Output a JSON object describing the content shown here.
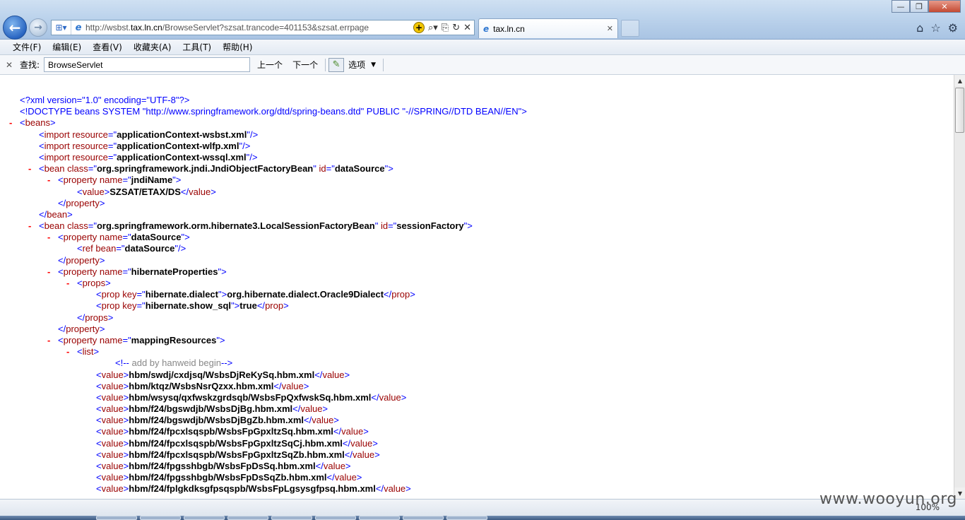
{
  "browser": {
    "url_prefix": "http://wsbst.",
    "url_host": "tax.ln.cn",
    "url_rest": "/BrowseServlet?szsat.trancode=401153&szsat.errpage",
    "tab_title": "tax.ln.cn",
    "tab_close": "✕",
    "window_controls": {
      "minimize": "—",
      "maximize": "❐",
      "close": "✕"
    },
    "zoom": "100%"
  },
  "menu": [
    "文件(F)",
    "编辑(E)",
    "查看(V)",
    "收藏夹(A)",
    "工具(T)",
    "帮助(H)"
  ],
  "find": {
    "close": "✕",
    "label": "查找:",
    "value": "BrowseServlet",
    "prev": "上一个",
    "next": "下一个",
    "options": "选项"
  },
  "watermark": "www.wooyun.org",
  "xml_lines": [
    {
      "minus": false,
      "indent": 0,
      "parts": [
        [
          "pi",
          "<?xml version=\"1.0\" encoding=\"UTF-8\"?>"
        ]
      ]
    },
    {
      "minus": false,
      "indent": 0,
      "parts": [
        [
          "pi",
          "<!DOCTYPE beans SYSTEM \"http://www.springframework.org/dtd/spring-beans.dtd\" PUBLIC \"-//SPRING//DTD BEAN//EN\">"
        ]
      ]
    },
    {
      "minus": true,
      "indent": 0,
      "parts": [
        [
          "bl",
          "<"
        ],
        [
          "tg",
          "beans"
        ],
        [
          "bl",
          ">"
        ]
      ]
    },
    {
      "minus": false,
      "indent": 1,
      "parts": [
        [
          "bl",
          "<"
        ],
        [
          "tg",
          "import"
        ],
        [
          "tg",
          " resource"
        ],
        [
          "bl",
          "=\""
        ],
        [
          "bd",
          "applicationContext-wsbst.xml"
        ],
        [
          "bl",
          "\"/>"
        ]
      ]
    },
    {
      "minus": false,
      "indent": 1,
      "parts": [
        [
          "bl",
          "<"
        ],
        [
          "tg",
          "import"
        ],
        [
          "tg",
          " resource"
        ],
        [
          "bl",
          "=\""
        ],
        [
          "bd",
          "applicationContext-wlfp.xml"
        ],
        [
          "bl",
          "\"/>"
        ]
      ]
    },
    {
      "minus": false,
      "indent": 1,
      "parts": [
        [
          "bl",
          "<"
        ],
        [
          "tg",
          "import"
        ],
        [
          "tg",
          " resource"
        ],
        [
          "bl",
          "=\""
        ],
        [
          "bd",
          "applicationContext-wssql.xml"
        ],
        [
          "bl",
          "\"/>"
        ]
      ]
    },
    {
      "minus": true,
      "indent": 1,
      "parts": [
        [
          "bl",
          "<"
        ],
        [
          "tg",
          "bean"
        ],
        [
          "tg",
          " class"
        ],
        [
          "bl",
          "=\""
        ],
        [
          "bd",
          "org.springframework.jndi.JndiObjectFactoryBean"
        ],
        [
          "bl",
          "\""
        ],
        [
          "tg",
          " id"
        ],
        [
          "bl",
          "=\""
        ],
        [
          "bd",
          "dataSource"
        ],
        [
          "bl",
          "\">"
        ]
      ]
    },
    {
      "minus": true,
      "indent": 2,
      "parts": [
        [
          "bl",
          "<"
        ],
        [
          "tg",
          "property"
        ],
        [
          "tg",
          " name"
        ],
        [
          "bl",
          "=\""
        ],
        [
          "bd",
          "jndiName"
        ],
        [
          "bl",
          "\">"
        ]
      ]
    },
    {
      "minus": false,
      "indent": 3,
      "parts": [
        [
          "bl",
          "<"
        ],
        [
          "tg",
          "value"
        ],
        [
          "bl",
          ">"
        ],
        [
          "bd",
          "SZSAT/ETAX/DS"
        ],
        [
          "bl",
          "</"
        ],
        [
          "tg",
          "value"
        ],
        [
          "bl",
          ">"
        ]
      ]
    },
    {
      "minus": false,
      "indent": 2,
      "parts": [
        [
          "bl",
          "</"
        ],
        [
          "tg",
          "property"
        ],
        [
          "bl",
          ">"
        ]
      ]
    },
    {
      "minus": false,
      "indent": 1,
      "parts": [
        [
          "bl",
          "</"
        ],
        [
          "tg",
          "bean"
        ],
        [
          "bl",
          ">"
        ]
      ]
    },
    {
      "minus": true,
      "indent": 1,
      "parts": [
        [
          "bl",
          "<"
        ],
        [
          "tg",
          "bean"
        ],
        [
          "tg",
          " class"
        ],
        [
          "bl",
          "=\""
        ],
        [
          "bd",
          "org.springframework.orm.hibernate3.LocalSessionFactoryBean"
        ],
        [
          "bl",
          "\""
        ],
        [
          "tg",
          " id"
        ],
        [
          "bl",
          "=\""
        ],
        [
          "bd",
          "sessionFactory"
        ],
        [
          "bl",
          "\">"
        ]
      ]
    },
    {
      "minus": true,
      "indent": 2,
      "parts": [
        [
          "bl",
          "<"
        ],
        [
          "tg",
          "property"
        ],
        [
          "tg",
          " name"
        ],
        [
          "bl",
          "=\""
        ],
        [
          "bd",
          "dataSource"
        ],
        [
          "bl",
          "\">"
        ]
      ]
    },
    {
      "minus": false,
      "indent": 3,
      "parts": [
        [
          "bl",
          "<"
        ],
        [
          "tg",
          "ref"
        ],
        [
          "tg",
          " bean"
        ],
        [
          "bl",
          "=\""
        ],
        [
          "bd",
          "dataSource"
        ],
        [
          "bl",
          "\"/>"
        ]
      ]
    },
    {
      "minus": false,
      "indent": 2,
      "parts": [
        [
          "bl",
          "</"
        ],
        [
          "tg",
          "property"
        ],
        [
          "bl",
          ">"
        ]
      ]
    },
    {
      "minus": true,
      "indent": 2,
      "parts": [
        [
          "bl",
          "<"
        ],
        [
          "tg",
          "property"
        ],
        [
          "tg",
          " name"
        ],
        [
          "bl",
          "=\""
        ],
        [
          "bd",
          "hibernateProperties"
        ],
        [
          "bl",
          "\">"
        ]
      ]
    },
    {
      "minus": true,
      "indent": 3,
      "parts": [
        [
          "bl",
          "<"
        ],
        [
          "tg",
          "props"
        ],
        [
          "bl",
          ">"
        ]
      ]
    },
    {
      "minus": false,
      "indent": 4,
      "parts": [
        [
          "bl",
          "<"
        ],
        [
          "tg",
          "prop"
        ],
        [
          "tg",
          " key"
        ],
        [
          "bl",
          "=\""
        ],
        [
          "bd",
          "hibernate.dialect"
        ],
        [
          "bl",
          "\">"
        ],
        [
          "bd",
          "org.hibernate.dialect.Oracle9Dialect"
        ],
        [
          "bl",
          "</"
        ],
        [
          "tg",
          "prop"
        ],
        [
          "bl",
          ">"
        ]
      ]
    },
    {
      "minus": false,
      "indent": 4,
      "parts": [
        [
          "bl",
          "<"
        ],
        [
          "tg",
          "prop"
        ],
        [
          "tg",
          " key"
        ],
        [
          "bl",
          "=\""
        ],
        [
          "bd",
          "hibernate.show_sql"
        ],
        [
          "bl",
          "\">"
        ],
        [
          "bd",
          "true"
        ],
        [
          "bl",
          "</"
        ],
        [
          "tg",
          "prop"
        ],
        [
          "bl",
          ">"
        ]
      ]
    },
    {
      "minus": false,
      "indent": 3,
      "parts": [
        [
          "bl",
          "</"
        ],
        [
          "tg",
          "props"
        ],
        [
          "bl",
          ">"
        ]
      ]
    },
    {
      "minus": false,
      "indent": 2,
      "parts": [
        [
          "bl",
          "</"
        ],
        [
          "tg",
          "property"
        ],
        [
          "bl",
          ">"
        ]
      ]
    },
    {
      "minus": true,
      "indent": 2,
      "parts": [
        [
          "bl",
          "<"
        ],
        [
          "tg",
          "property"
        ],
        [
          "tg",
          " name"
        ],
        [
          "bl",
          "=\""
        ],
        [
          "bd",
          "mappingResources"
        ],
        [
          "bl",
          "\">"
        ]
      ]
    },
    {
      "minus": true,
      "indent": 3,
      "parts": [
        [
          "bl",
          "<"
        ],
        [
          "tg",
          "list"
        ],
        [
          "bl",
          ">"
        ]
      ]
    },
    {
      "minus": false,
      "indent": 5,
      "parts": [
        [
          "bl",
          "<!--"
        ],
        [
          "cm",
          " add by hanweid begin"
        ],
        [
          "bl",
          "-->"
        ]
      ]
    },
    {
      "minus": false,
      "indent": 4,
      "parts": [
        [
          "bl",
          "<"
        ],
        [
          "tg",
          "value"
        ],
        [
          "bl",
          ">"
        ],
        [
          "bd",
          "hbm/swdj/cxdjsq/WsbsDjReKySq.hbm.xml"
        ],
        [
          "bl",
          "</"
        ],
        [
          "tg",
          "value"
        ],
        [
          "bl",
          ">"
        ]
      ]
    },
    {
      "minus": false,
      "indent": 4,
      "parts": [
        [
          "bl",
          "<"
        ],
        [
          "tg",
          "value"
        ],
        [
          "bl",
          ">"
        ],
        [
          "bd",
          "hbm/ktqz/WsbsNsrQzxx.hbm.xml"
        ],
        [
          "bl",
          "</"
        ],
        [
          "tg",
          "value"
        ],
        [
          "bl",
          ">"
        ]
      ]
    },
    {
      "minus": false,
      "indent": 4,
      "parts": [
        [
          "bl",
          "<"
        ],
        [
          "tg",
          "value"
        ],
        [
          "bl",
          ">"
        ],
        [
          "bd",
          "hbm/wsysq/qxfwskzgrdsqb/WsbsFpQxfwskSq.hbm.xml"
        ],
        [
          "bl",
          "</"
        ],
        [
          "tg",
          "value"
        ],
        [
          "bl",
          ">"
        ]
      ]
    },
    {
      "minus": false,
      "indent": 4,
      "parts": [
        [
          "bl",
          "<"
        ],
        [
          "tg",
          "value"
        ],
        [
          "bl",
          ">"
        ],
        [
          "bd",
          "hbm/f24/bgswdjb/WsbsDjBg.hbm.xml"
        ],
        [
          "bl",
          "</"
        ],
        [
          "tg",
          "value"
        ],
        [
          "bl",
          ">"
        ]
      ]
    },
    {
      "minus": false,
      "indent": 4,
      "parts": [
        [
          "bl",
          "<"
        ],
        [
          "tg",
          "value"
        ],
        [
          "bl",
          ">"
        ],
        [
          "bd",
          "hbm/f24/bgswdjb/WsbsDjBgZb.hbm.xml"
        ],
        [
          "bl",
          "</"
        ],
        [
          "tg",
          "value"
        ],
        [
          "bl",
          ">"
        ]
      ]
    },
    {
      "minus": false,
      "indent": 4,
      "parts": [
        [
          "bl",
          "<"
        ],
        [
          "tg",
          "value"
        ],
        [
          "bl",
          ">"
        ],
        [
          "bd",
          "hbm/f24/fpcxlsqspb/WsbsFpGpxltzSq.hbm.xml"
        ],
        [
          "bl",
          "</"
        ],
        [
          "tg",
          "value"
        ],
        [
          "bl",
          ">"
        ]
      ]
    },
    {
      "minus": false,
      "indent": 4,
      "parts": [
        [
          "bl",
          "<"
        ],
        [
          "tg",
          "value"
        ],
        [
          "bl",
          ">"
        ],
        [
          "bd",
          "hbm/f24/fpcxlsqspb/WsbsFpGpxltzSqCj.hbm.xml"
        ],
        [
          "bl",
          "</"
        ],
        [
          "tg",
          "value"
        ],
        [
          "bl",
          ">"
        ]
      ]
    },
    {
      "minus": false,
      "indent": 4,
      "parts": [
        [
          "bl",
          "<"
        ],
        [
          "tg",
          "value"
        ],
        [
          "bl",
          ">"
        ],
        [
          "bd",
          "hbm/f24/fpcxlsqspb/WsbsFpGpxltzSqZb.hbm.xml"
        ],
        [
          "bl",
          "</"
        ],
        [
          "tg",
          "value"
        ],
        [
          "bl",
          ">"
        ]
      ]
    },
    {
      "minus": false,
      "indent": 4,
      "parts": [
        [
          "bl",
          "<"
        ],
        [
          "tg",
          "value"
        ],
        [
          "bl",
          ">"
        ],
        [
          "bd",
          "hbm/f24/fpgsshbgb/WsbsFpDsSq.hbm.xml"
        ],
        [
          "bl",
          "</"
        ],
        [
          "tg",
          "value"
        ],
        [
          "bl",
          ">"
        ]
      ]
    },
    {
      "minus": false,
      "indent": 4,
      "parts": [
        [
          "bl",
          "<"
        ],
        [
          "tg",
          "value"
        ],
        [
          "bl",
          ">"
        ],
        [
          "bd",
          "hbm/f24/fpgsshbgb/WsbsFpDsSqZb.hbm.xml"
        ],
        [
          "bl",
          "</"
        ],
        [
          "tg",
          "value"
        ],
        [
          "bl",
          ">"
        ]
      ]
    },
    {
      "minus": false,
      "indent": 4,
      "parts": [
        [
          "bl",
          "<"
        ],
        [
          "tg",
          "value"
        ],
        [
          "bl",
          ">"
        ],
        [
          "bd",
          "hbm/f24/fplgkdksgfpsqspb/WsbsFpLgsysgfpsq.hbm.xml"
        ],
        [
          "bl",
          "</"
        ],
        [
          "tg",
          "value"
        ],
        [
          "bl",
          ">"
        ]
      ]
    }
  ]
}
